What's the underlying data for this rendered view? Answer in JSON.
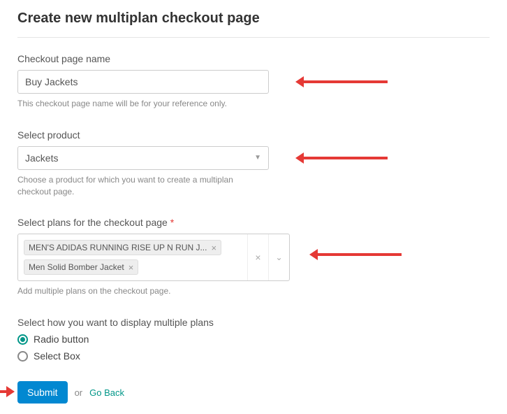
{
  "page_title": "Create new multiplan checkout page",
  "fields": {
    "name": {
      "label": "Checkout page name",
      "value": "Buy Jackets",
      "help": "This checkout page name will be for your reference only."
    },
    "product": {
      "label": "Select product",
      "value": "Jackets",
      "help": "Choose a product for which you want to create a multiplan checkout page."
    },
    "plans": {
      "label": "Select plans for the checkout page",
      "required_marker": "*",
      "tags": [
        "MEN'S ADIDAS RUNNING RISE UP N RUN J...",
        "Men Solid Bomber Jacket"
      ],
      "help": "Add multiple plans on the checkout page."
    },
    "display": {
      "label": "Select how you want to display multiple plans",
      "options": [
        {
          "label": "Radio button",
          "selected": true
        },
        {
          "label": "Select Box",
          "selected": false
        }
      ]
    }
  },
  "actions": {
    "submit": "Submit",
    "or": "or",
    "go_back": "Go Back"
  }
}
